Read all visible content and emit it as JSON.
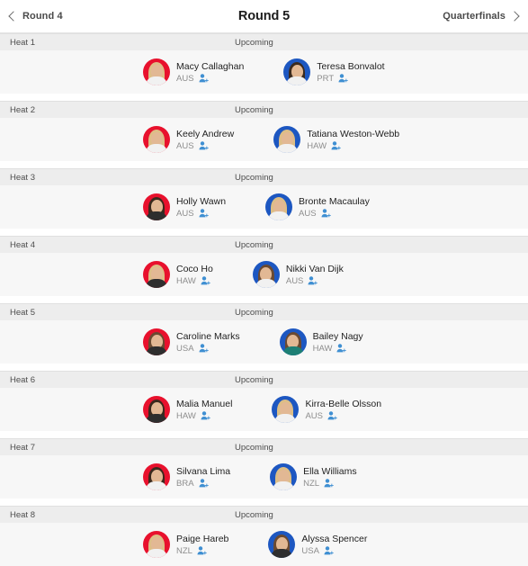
{
  "nav": {
    "prev_label": "Round 4",
    "title": "Round 5",
    "next_label": "Quarterfinals",
    "prev_icon": "chevron-left-icon",
    "next_icon": "chevron-right-icon"
  },
  "colors": {
    "surfer_left_ring": "#e8112d",
    "surfer_right_ring": "#1d57c1",
    "add_icon": "#3f8fd2",
    "heat_header_bg": "#ededed",
    "heat_body_bg": "#f7f7f7"
  },
  "icons": {
    "add_athlete": "add-athlete-icon"
  },
  "heats": [
    {
      "label": "Heat 1",
      "status": "Upcoming",
      "surfers": [
        {
          "name": "Macy Callaghan",
          "country": "AUS",
          "ring": "red",
          "hair": "blonde",
          "top": "light"
        },
        {
          "name": "Teresa Bonvalot",
          "country": "PRT",
          "ring": "blue",
          "hair": "dark",
          "top": "light"
        }
      ]
    },
    {
      "label": "Heat 2",
      "status": "Upcoming",
      "surfers": [
        {
          "name": "Keely Andrew",
          "country": "AUS",
          "ring": "red",
          "hair": "blonde",
          "top": "light"
        },
        {
          "name": "Tatiana Weston-Webb",
          "country": "HAW",
          "ring": "blue",
          "hair": "blonde",
          "top": "light"
        }
      ]
    },
    {
      "label": "Heat 3",
      "status": "Upcoming",
      "surfers": [
        {
          "name": "Holly Wawn",
          "country": "AUS",
          "ring": "red",
          "hair": "dark",
          "top": "dark"
        },
        {
          "name": "Bronte Macaulay",
          "country": "AUS",
          "ring": "blue",
          "hair": "blonde",
          "top": "light"
        }
      ]
    },
    {
      "label": "Heat 4",
      "status": "Upcoming",
      "surfers": [
        {
          "name": "Coco Ho",
          "country": "HAW",
          "ring": "red",
          "hair": "blonde",
          "top": "dark"
        },
        {
          "name": "Nikki Van Dijk",
          "country": "AUS",
          "ring": "blue",
          "hair": "brown",
          "top": "light"
        }
      ]
    },
    {
      "label": "Heat 5",
      "status": "Upcoming",
      "surfers": [
        {
          "name": "Caroline Marks",
          "country": "USA",
          "ring": "red",
          "hair": "brown",
          "top": "dark"
        },
        {
          "name": "Bailey Nagy",
          "country": "HAW",
          "ring": "blue",
          "hair": "brown",
          "top": "teal"
        }
      ]
    },
    {
      "label": "Heat 6",
      "status": "Upcoming",
      "surfers": [
        {
          "name": "Malia Manuel",
          "country": "HAW",
          "ring": "red",
          "hair": "dark",
          "top": "dark"
        },
        {
          "name": "Kirra-Belle Olsson",
          "country": "AUS",
          "ring": "blue",
          "hair": "blonde",
          "top": "light"
        }
      ]
    },
    {
      "label": "Heat 7",
      "status": "Upcoming",
      "surfers": [
        {
          "name": "Silvana Lima",
          "country": "BRA",
          "ring": "red",
          "hair": "dark",
          "top": "light"
        },
        {
          "name": "Ella Williams",
          "country": "NZL",
          "ring": "blue",
          "hair": "blonde",
          "top": "light"
        }
      ]
    },
    {
      "label": "Heat 8",
      "status": "Upcoming",
      "surfers": [
        {
          "name": "Paige Hareb",
          "country": "NZL",
          "ring": "red",
          "hair": "blonde",
          "top": "light"
        },
        {
          "name": "Alyssa Spencer",
          "country": "USA",
          "ring": "blue",
          "hair": "brown",
          "top": "dark"
        }
      ]
    }
  ]
}
